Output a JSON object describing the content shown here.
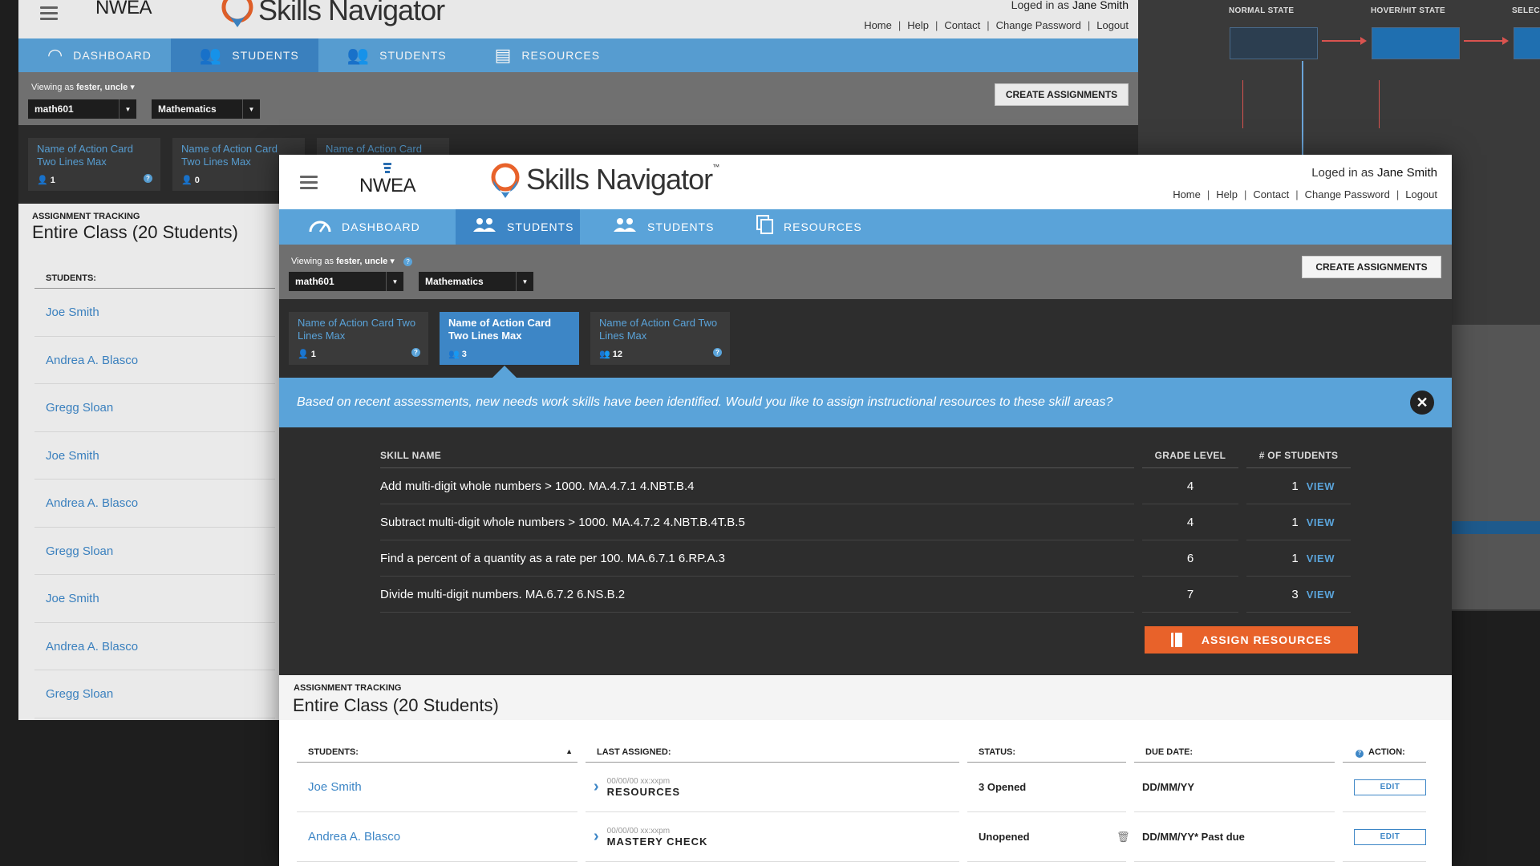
{
  "app": {
    "brand_org": "NWEA",
    "brand_product": "Skills Navigator",
    "trademark": "™",
    "login_prefix": "Loged in as",
    "user_name": "Jane Smith",
    "header_links": [
      "Home",
      "Help",
      "Contact",
      "Change Password",
      "Logout"
    ],
    "link_separator": "|"
  },
  "nav": {
    "tabs": [
      {
        "label": "DASHBOARD",
        "icon": "gauge-icon",
        "active": false
      },
      {
        "label": "STUDENTS",
        "icon": "users-icon",
        "active": true
      },
      {
        "label": "STUDENTS",
        "icon": "users-icon",
        "active": false
      },
      {
        "label": "RESOURCES",
        "icon": "resources-icon",
        "active": false
      }
    ]
  },
  "toolbar": {
    "viewing_prefix": "Viewing as",
    "viewing_user": "fester, uncle",
    "class_select": "math601",
    "subject_select": "Mathematics",
    "create_button": "CREATE ASSIGNMENTS"
  },
  "action_cards": [
    {
      "name": "Name of Action Card Two Lines Max",
      "count": "1",
      "selected": false
    },
    {
      "name": "Name of Action Card Two Lines Max",
      "count": "3",
      "selected": true
    },
    {
      "name": "Name of Action Card Two Lines Max",
      "count": "12",
      "selected": false
    }
  ],
  "bg_action_cards": [
    {
      "name": "Name of Action Card Two Lines Max",
      "count": "1"
    },
    {
      "name": "Name of Action Card Two Lines Max",
      "count": "0"
    },
    {
      "name": "Name of Action Card"
    }
  ],
  "banner": {
    "message": "Based on recent assessments, new needs work skills have been identified. Would you like to assign instructional resources to these skill areas?"
  },
  "skills": {
    "headers": [
      "SKILL NAME",
      "GRADE LEVEL",
      "# OF STUDENTS"
    ],
    "view_label": "VIEW",
    "rows": [
      {
        "name": "Add multi-digit whole numbers > 1000. MA.4.7.1 4.NBT.B.4",
        "grade": "4",
        "students": "1"
      },
      {
        "name": "Subtract multi-digit whole numbers > 1000. MA.4.7.2 4.NBT.B.4T.B.5",
        "grade": "4",
        "students": "1"
      },
      {
        "name": "Find a percent of a quantity as a rate per 100. MA.6.7.1 6.RP.A.3",
        "grade": "6",
        "students": "1"
      },
      {
        "name": "Divide multi-digit numbers. MA.6.7.2 6.NS.B.2",
        "grade": "7",
        "students": "3"
      }
    ],
    "assign_button": "ASSIGN RESOURCES"
  },
  "tracking": {
    "label": "ASSIGNMENT TRACKING",
    "title": "Entire Class (20 Students)",
    "headers": [
      "STUDENTS:",
      "LAST ASSIGNED:",
      "STATUS:",
      "DUE DATE:",
      "ACTION:"
    ],
    "edit_label": "EDIT",
    "rows": [
      {
        "student": "Joe Smith",
        "date": "00/00/00 xx:xxpm",
        "type": "RESOURCES",
        "status": "3 Opened",
        "due": "DD/MM/YY"
      },
      {
        "student": "Andrea A. Blasco",
        "date": "00/00/00 xx:xxpm",
        "type": "MASTERY CHECK",
        "status": "Unopened",
        "due": "DD/MM/YY* Past due"
      }
    ]
  },
  "bg_tracking": {
    "label": "ASSIGNMENT TRACKING",
    "title": "Entire Class (20 Students)",
    "students_header": "STUDENTS:",
    "students": [
      "Joe Smith",
      "Andrea A. Blasco",
      "Gregg Sloan",
      "Joe Smith",
      "Andrea A. Blasco",
      "Gregg Sloan",
      "Joe Smith",
      "Andrea A. Blasco",
      "Gregg Sloan"
    ]
  },
  "spec_panel": {
    "labels": [
      "NORMAL STATE",
      "HOVER/HIT STATE",
      "SELEC"
    ]
  },
  "colors": {
    "accent_blue": "#5aa3d9",
    "active_tab": "#3d86c6",
    "assign_orange": "#e8622a",
    "dark_bg": "#2d2d2d"
  }
}
